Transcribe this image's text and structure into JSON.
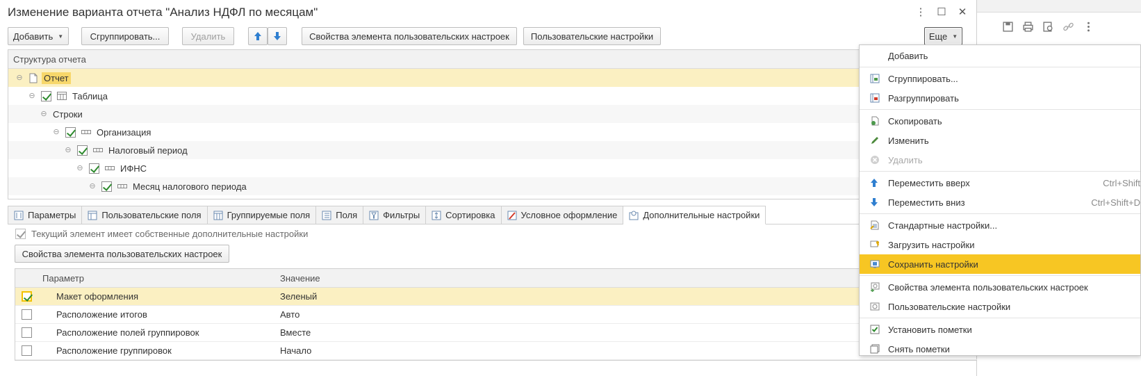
{
  "window": {
    "title": "Изменение варианта отчета \"Анализ НДФЛ по месяцам\""
  },
  "toolbar": {
    "add_label": "Добавить",
    "group_label": "Сгруппировать...",
    "delete_label": "Удалить",
    "element_props_label": "Свойства элемента пользовательских настроек",
    "user_settings_label": "Пользовательские настройки",
    "more_label": "Еще"
  },
  "structure": {
    "header": "Структура отчета",
    "rows": [
      {
        "label": "Отчет"
      },
      {
        "label": "Таблица"
      },
      {
        "label": "Строки"
      },
      {
        "label": "Организация"
      },
      {
        "label": "Налоговый период"
      },
      {
        "label": "ИФНС"
      },
      {
        "label": "Месяц налогового периода"
      }
    ]
  },
  "tabs": [
    {
      "label": "Параметры"
    },
    {
      "label": "Пользовательские поля"
    },
    {
      "label": "Группируемые поля"
    },
    {
      "label": "Поля"
    },
    {
      "label": "Фильтры"
    },
    {
      "label": "Сортировка"
    },
    {
      "label": "Условное оформление"
    },
    {
      "label": "Дополнительные настройки"
    }
  ],
  "extra": {
    "own_settings_label": "Текущий элемент имеет собственные дополнительные настройки",
    "element_props_button": "Свойства элемента пользовательских настроек"
  },
  "params_table": {
    "col_param": "Параметр",
    "col_value": "Значение",
    "rows": [
      {
        "param": "Макет оформления",
        "value": "Зеленый",
        "checked": true
      },
      {
        "param": "Расположение итогов",
        "value": "Авто",
        "checked": false
      },
      {
        "param": "Расположение полей группировок",
        "value": "Вместе",
        "checked": false
      },
      {
        "param": "Расположение группировок",
        "value": "Начало",
        "checked": false
      }
    ]
  },
  "menu": {
    "items": [
      {
        "label": "Добавить"
      },
      {
        "label": "Сгруппировать..."
      },
      {
        "label": "Разгруппировать"
      },
      {
        "label": "Скопировать"
      },
      {
        "label": "Изменить"
      },
      {
        "label": "Удалить"
      },
      {
        "label": "Переместить вверх",
        "shortcut": "Ctrl+Shift"
      },
      {
        "label": "Переместить вниз",
        "shortcut": "Ctrl+Shift+D"
      },
      {
        "label": "Стандартные настройки..."
      },
      {
        "label": "Загрузить настройки"
      },
      {
        "label": "Сохранить настройки"
      },
      {
        "label": "Свойства элемента пользовательских настроек"
      },
      {
        "label": "Пользовательские настройки"
      },
      {
        "label": "Установить пометки"
      },
      {
        "label": "Снять пометки"
      }
    ]
  },
  "colors": {
    "selection": "#fbf0c2",
    "highlight": "#f7d76a",
    "menu_active": "#f7c623",
    "check": "#2e8b2e",
    "arrow_blue": "#2f7fd0"
  }
}
